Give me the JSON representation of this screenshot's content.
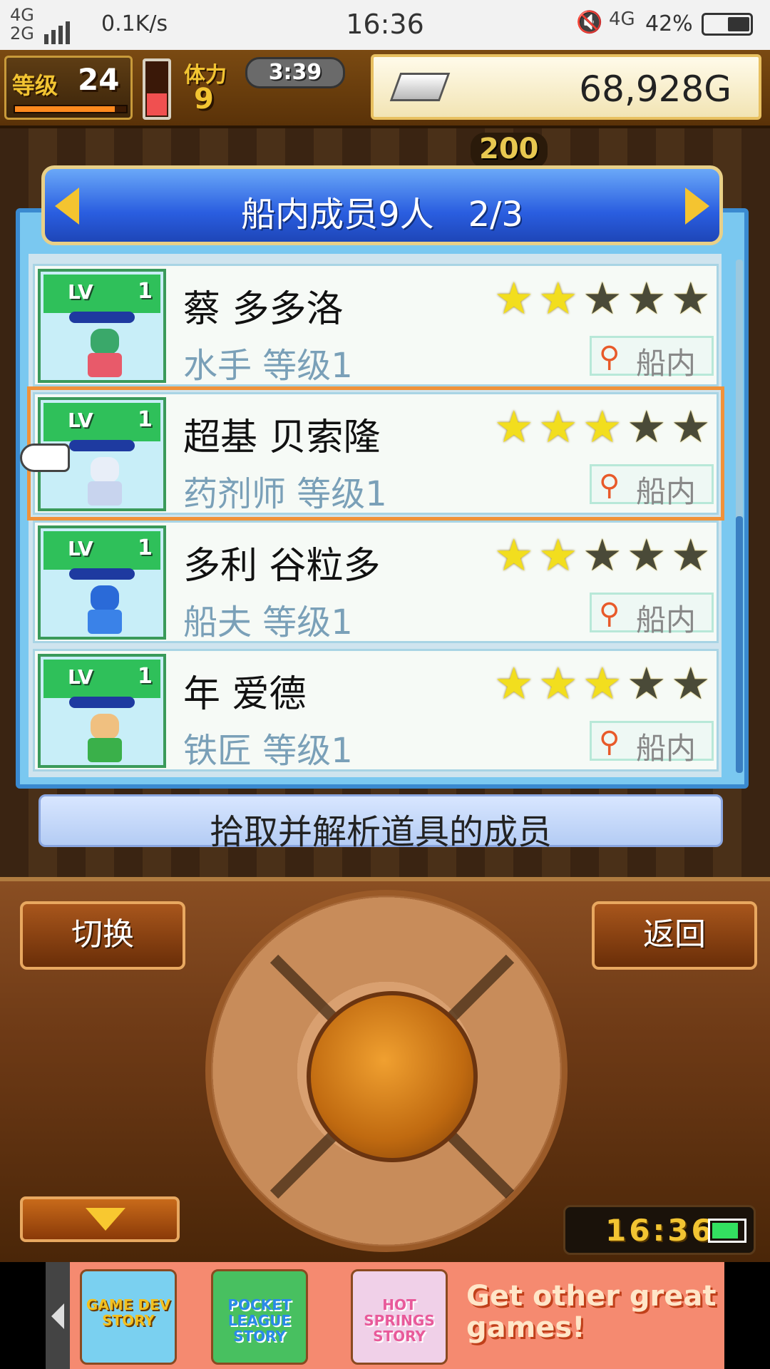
{
  "status_bar": {
    "network_top": "4G",
    "network_bottom": "2G",
    "speed": "0.1K/s",
    "time": "16:36",
    "network_right": "4G",
    "battery": "42%"
  },
  "hud": {
    "level_label": "等级",
    "level": "24",
    "stamina_label": "体力",
    "stamina": "9",
    "timer": "3:39",
    "money": "68,928G",
    "resource": "200"
  },
  "panel": {
    "title": "船内成员9人　2/3",
    "description": "拾取并解析道具的成员"
  },
  "members": [
    {
      "lv_label": "LV",
      "level": "1",
      "name": "蔡 多多洛",
      "job": "水手 等级1",
      "stars": 2,
      "status": "船内"
    },
    {
      "lv_label": "LV",
      "level": "1",
      "name": "超基 贝索隆",
      "job": "药剂师 等级1",
      "stars": 3,
      "status": "船内"
    },
    {
      "lv_label": "LV",
      "level": "1",
      "name": "多利 谷粒多",
      "job": "船夫 等级1",
      "stars": 2,
      "status": "船内"
    },
    {
      "lv_label": "LV",
      "level": "1",
      "name": "年 爱德",
      "job": "铁匠 等级1",
      "stars": 3,
      "status": "船内"
    }
  ],
  "controls": {
    "switch_label": "切换",
    "back_label": "返回",
    "clock": "16:36"
  },
  "ad": {
    "games": [
      "GAME DEV STORY",
      "POCKET LEAGUE STORY",
      "HOT SPRINGS STORY"
    ],
    "cta": "Get other great games!"
  },
  "colors": {
    "accent_orange": "#f0923a",
    "panel_blue": "#2a5ee0",
    "star_on": "#f2de1e",
    "star_off": "#4a4a38"
  }
}
